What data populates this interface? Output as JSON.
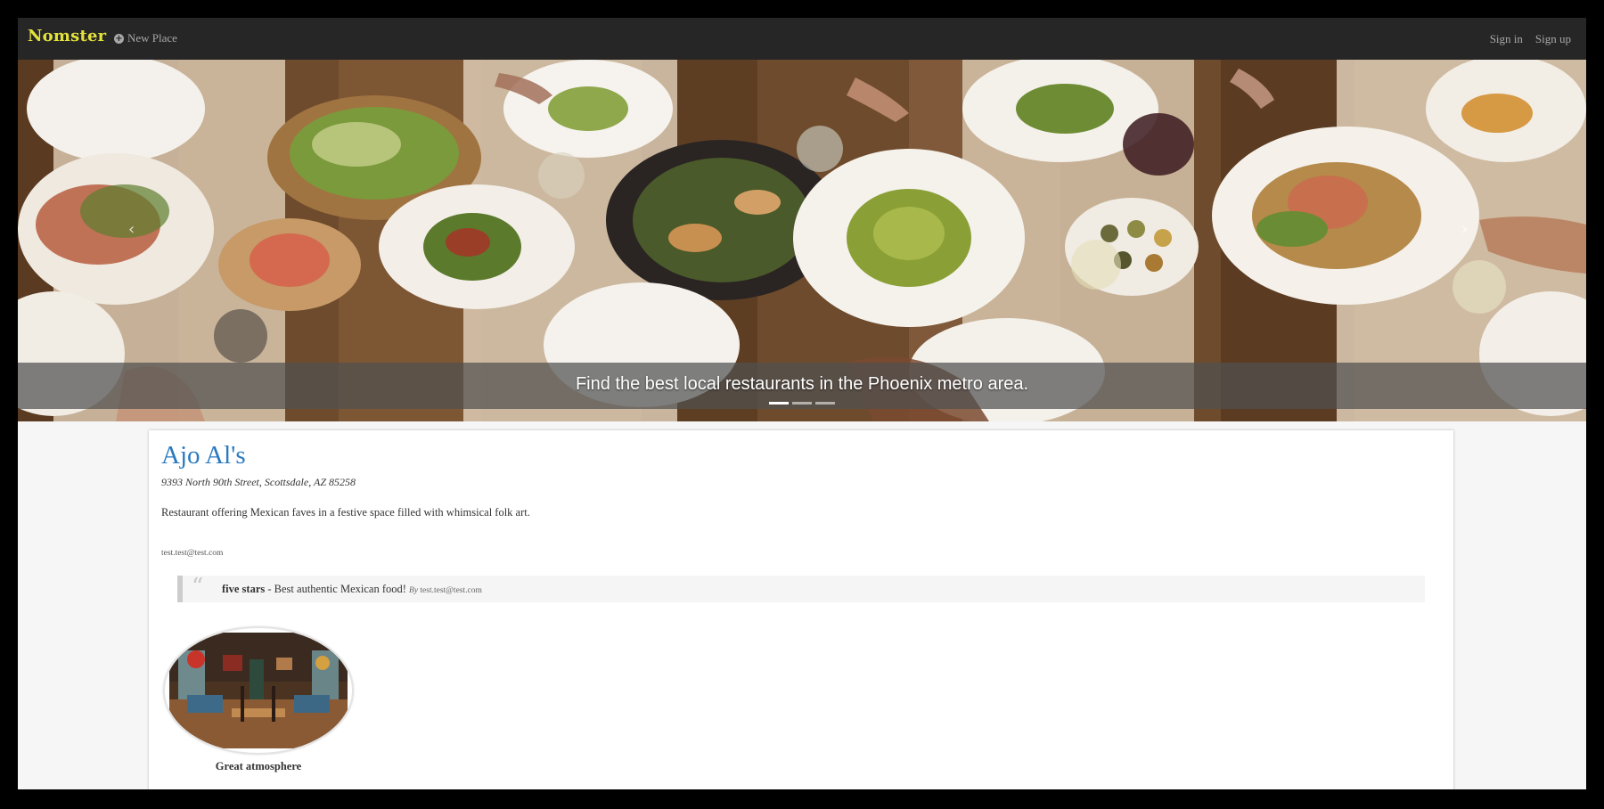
{
  "navbar": {
    "brand": "Nomster",
    "new_place_label": "New Place",
    "sign_in_label": "Sign in",
    "sign_up_label": "Sign up"
  },
  "carousel": {
    "caption": "Find the best local restaurants in the Phoenix metro area.",
    "slide_count": 3,
    "active_slide": 1,
    "prev_icon": "chevron-left-icon",
    "next_icon": "chevron-right-icon"
  },
  "place": {
    "name": "Ajo Al's",
    "address": "9393 North 90th Street, Scottsdale, AZ 85258",
    "description": "Restaurant offering Mexican faves in a festive space filled with whimsical folk art.",
    "owner_email": "test.test@test.com"
  },
  "review": {
    "rating": "five stars",
    "separator": " - ",
    "comment": "Best authentic Mexican food!",
    "by_label": "By",
    "author": "test.test@test.com"
  },
  "photo": {
    "caption": "Great atmosphere"
  },
  "colors": {
    "navbar_bg": "#262626",
    "brand": "#e3e23c",
    "place_name": "#2a7ac0"
  }
}
